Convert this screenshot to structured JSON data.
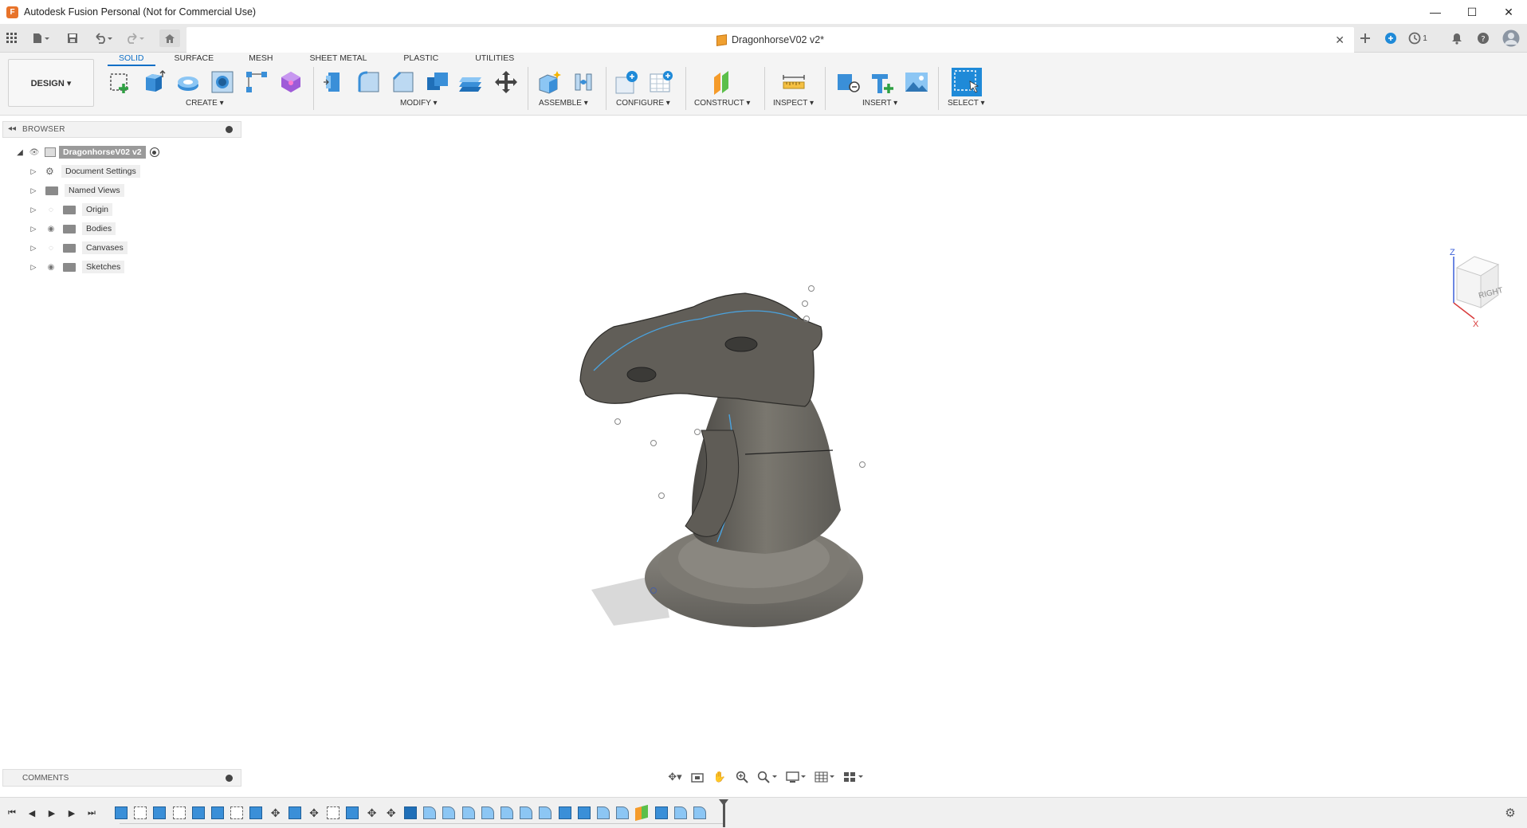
{
  "window": {
    "title": "Autodesk Fusion Personal (Not for Commercial Use)",
    "logo_letter": "F",
    "min": "—",
    "max": "☐",
    "close": "✕"
  },
  "document": {
    "name": "DragonhorseV02 v2*",
    "close": "✕"
  },
  "workspace": {
    "label": "DESIGN ▾"
  },
  "tabs": [
    "SOLID",
    "SURFACE",
    "MESH",
    "SHEET METAL",
    "PLASTIC",
    "UTILITIES"
  ],
  "groups": {
    "create": "CREATE ▾",
    "modify": "MODIFY ▾",
    "assemble": "ASSEMBLE ▾",
    "configure": "CONFIGURE ▾",
    "construct": "CONSTRUCT ▾",
    "inspect": "INSPECT ▾",
    "insert": "INSERT ▾",
    "select": "SELECT ▾"
  },
  "browser": {
    "title": "BROWSER",
    "root": "DragonhorseV02 v2",
    "items": [
      "Document Settings",
      "Named Views",
      "Origin",
      "Bodies",
      "Canvases",
      "Sketches"
    ]
  },
  "viewcube": {
    "face": "RIGHT",
    "axis_z": "Z",
    "axis_x": "X"
  },
  "comments": {
    "title": "COMMENTS"
  },
  "notifications": {
    "count": "1"
  },
  "colors": {
    "accent": "#0f6fc6",
    "body": "#6b6861",
    "sketch": "#4aa3df"
  }
}
